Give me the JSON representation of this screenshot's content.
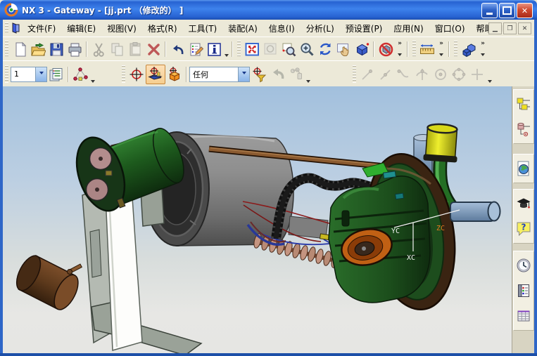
{
  "window": {
    "title": "NX 3 - Gateway - [jj.prt （修改的） ]",
    "controls": [
      "minimize",
      "maximize",
      "close"
    ]
  },
  "menu": {
    "items": [
      {
        "label": "文件(F)"
      },
      {
        "label": "编辑(E)"
      },
      {
        "label": "视图(V)"
      },
      {
        "label": "格式(R)"
      },
      {
        "label": "工具(T)"
      },
      {
        "label": "装配(A)"
      },
      {
        "label": "信息(I)"
      },
      {
        "label": "分析(L)"
      },
      {
        "label": "预设置(P)"
      },
      {
        "label": "应用(N)"
      },
      {
        "label": "窗口(O)"
      },
      {
        "label": "帮助(H)"
      }
    ],
    "mdi_controls": [
      "minimize",
      "restore",
      "close"
    ]
  },
  "toolbars": {
    "standard": {
      "icons": [
        "new",
        "open",
        "save",
        "print",
        "cut",
        "copy",
        "paste",
        "delete",
        "undo",
        "edit-list",
        "information"
      ]
    },
    "view": {
      "icons": [
        "fit",
        "zoom-to-selection",
        "zoom-window",
        "zoom-in-out",
        "rotate",
        "pan",
        "shaded-cube",
        "no-selection"
      ],
      "overflow": "»"
    },
    "measure": {
      "icons": [
        "measure-distance"
      ],
      "overflow": "»"
    },
    "application": {
      "icons": [
        "application-blocks"
      ],
      "overflow": "»"
    },
    "utility": {
      "layer_value": "1",
      "icons": [
        "layer-settings",
        "node-network"
      ]
    },
    "selection": {
      "scope_value": "任何",
      "icons": [
        "wcs-crosshair",
        "wcs-dynamics",
        "wcs-orient",
        "selection-filter",
        "back-arrow",
        "chain-links"
      ],
      "active_icon": "wcs-dynamics"
    },
    "snap_point": {
      "icons": [
        "end-point",
        "mid-point",
        "point-on-curve",
        "intersection-point",
        "center-point",
        "quadrant-point",
        "existing-point"
      ]
    }
  },
  "viewport": {
    "wcs": {
      "yc": "YC",
      "xc": "XC",
      "zc": "ZC"
    },
    "background_top": "#A2C0DD",
    "background_bottom": "#E7E7E4"
  },
  "sidebar": {
    "items": [
      "assembly-navigator",
      "part-navigator",
      "web-browser",
      "tutorials",
      "help",
      "history",
      "notebook",
      "table"
    ],
    "help_glyph": "?"
  },
  "colors": {
    "titlebar_blue": "#2763D2",
    "chrome_tan": "#ECE9D8",
    "model": {
      "canister_gray": "#8E8E8E",
      "motor_green": "#1E5C1E",
      "flange_brown": "#3A2412",
      "pump_orange": "#C06014",
      "cap_yellow": "#D8D818",
      "filter_brown": "#6B4226",
      "port_blue": "#8FA8C8",
      "hose_black": "#161616",
      "spring_tan": "#C09078",
      "wire_red": "#8B1A1A",
      "wire_blue": "#2838A8",
      "rod_brown": "#8A5A30",
      "bracket_white": "#FDFDFB",
      "zc_label_orange": "#E87820"
    }
  }
}
